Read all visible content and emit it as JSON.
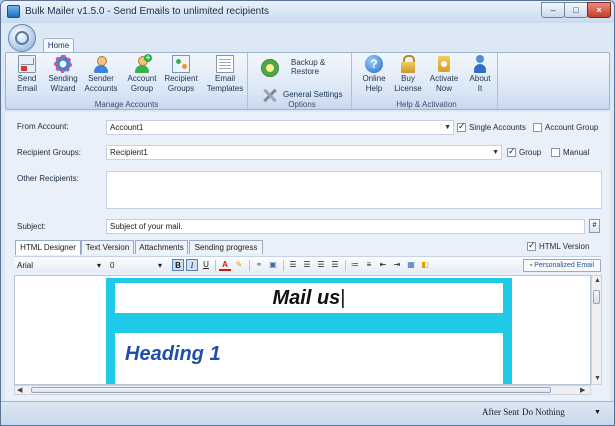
{
  "window": {
    "title": "Bulk Mailer v1.5.0 - Send Emails to unlimited recipients"
  },
  "ribbon": {
    "tab": "Home",
    "groups": [
      {
        "label": "Manage Accounts",
        "buttons": [
          {
            "line1": "Send",
            "line2": "Email",
            "icon": "send-email-icon"
          },
          {
            "line1": "Sending",
            "line2": "Wizard",
            "icon": "wizard-gear-icon"
          },
          {
            "line1": "Sender",
            "line2": "Accounts",
            "icon": "sender-accounts-icon"
          },
          {
            "line1": "Account",
            "line2": "Group",
            "icon": "account-group-icon"
          },
          {
            "line1": "Recipient",
            "line2": "Groups",
            "icon": "recipient-groups-icon"
          },
          {
            "line1": "Email",
            "line2": "Templates",
            "icon": "email-templates-icon"
          }
        ]
      },
      {
        "label": "Options",
        "buttons": [
          {
            "line1": "Backup &",
            "line2": "Restore",
            "icon": "backup-restore-icon"
          },
          {
            "line1": "General Settings",
            "line2": "",
            "icon": "general-settings-icon"
          }
        ]
      },
      {
        "label": "Help & Activation",
        "buttons": [
          {
            "line1": "Online",
            "line2": "Help",
            "icon": "help-icon"
          },
          {
            "line1": "Buy",
            "line2": "License",
            "icon": "license-lock-icon"
          },
          {
            "line1": "Activate",
            "line2": "Now",
            "icon": "activate-icon"
          },
          {
            "line1": "About",
            "line2": "It",
            "icon": "about-icon"
          }
        ]
      }
    ]
  },
  "form": {
    "from_account": {
      "label": "From Account:",
      "value": "Account1",
      "single_accounts": "Single Accounts",
      "account_group": "Account Group"
    },
    "recipient_groups": {
      "label": "Recipient Groups:",
      "value": "Recipient1",
      "group": "Group",
      "manual": "Manual"
    },
    "other_recipients": {
      "label": "Other Recipients:",
      "value": ""
    },
    "subject": {
      "label": "Subject:",
      "value": "Subject of your mail.",
      "button": "#"
    }
  },
  "editor": {
    "tabs": [
      "HTML Designer",
      "Text Version",
      "Attachments",
      "Sending progress"
    ],
    "html_version": "HTML Version",
    "font": "Arial",
    "size": "0",
    "bold": "B",
    "italic": "I",
    "underline": "U",
    "personalized": "Personalized Email",
    "content": {
      "heading": "Mail us",
      "heading1": "Heading 1"
    }
  },
  "status": {
    "label": "After Sent",
    "value": "Do Nothing"
  },
  "colors": {
    "accent": "#1fc9e8",
    "heading": "#1f4fa8"
  }
}
